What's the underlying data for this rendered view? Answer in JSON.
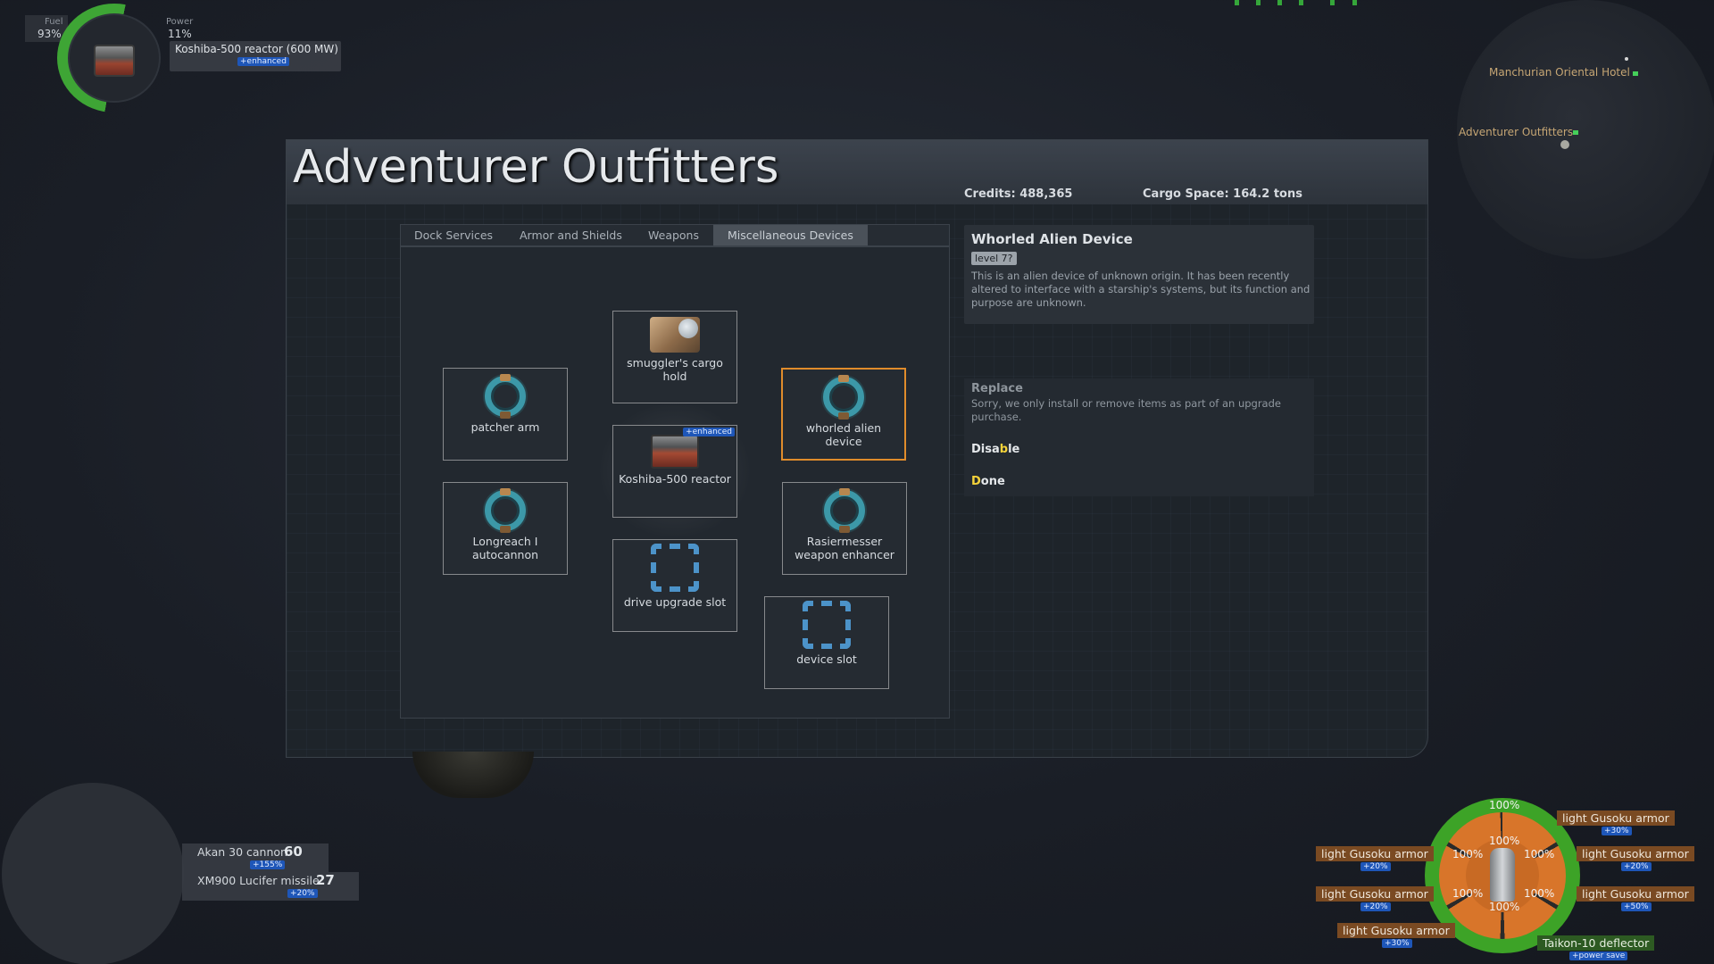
{
  "hud_top_left": {
    "fuel_label": "Fuel",
    "fuel_value": "93%",
    "power_label": "Power",
    "power_value": "11%",
    "reactor_name": "Koshiba-500 reactor (600 MW)",
    "reactor_badge": "+enhanced"
  },
  "minimap": {
    "locations": [
      "Manchurian Oriental Hotel",
      "Adventurer Outfitters"
    ]
  },
  "panel": {
    "title": "Adventurer Outfitters",
    "credits": "Credits: 488,365",
    "cargo": "Cargo Space:  164.2 tons"
  },
  "tabs": [
    "Dock Services",
    "Armor and Shields",
    "Weapons",
    "Miscellaneous Devices"
  ],
  "active_tab": "Miscellaneous Devices",
  "slots": {
    "cargo": {
      "label": "smuggler's cargo hold",
      "icon": "cargo-crate-icon"
    },
    "patcher": {
      "label": "patcher arm",
      "icon": "alien-ring-icon"
    },
    "whorled": {
      "label": "whorled alien device",
      "icon": "alien-ring-icon",
      "selected": true
    },
    "reactor": {
      "label": "Koshiba-500 reactor",
      "badge": "+enhanced",
      "icon": "reactor-icon"
    },
    "longreach": {
      "label": "Longreach I autocannon",
      "icon": "alien-ring-icon"
    },
    "rasier": {
      "label": "Rasiermesser weapon enhancer",
      "icon": "alien-ring-icon"
    },
    "drive": {
      "label": "drive upgrade slot",
      "icon": "empty-slot-icon"
    },
    "device": {
      "label": "device slot",
      "icon": "empty-slot-icon"
    }
  },
  "info": {
    "title": "Whorled Alien Device",
    "level": "level 7?",
    "description": "This is an alien device of unknown origin. It has been recently altered to interface with a starship's systems, but its function and purpose are unknown."
  },
  "actions": {
    "replace_label": "Replace",
    "replace_desc": "Sorry, we only install or remove items as part of an upgrade purchase.",
    "disable_pre": "Disa",
    "disable_key": "b",
    "disable_post": "le",
    "done_key": "D",
    "done_post": "one"
  },
  "weapons": [
    {
      "name": "Akan 30 cannon",
      "ammo": "60",
      "bonus": "+155%"
    },
    {
      "name": "XM900 Lucifer missile",
      "ammo": "27",
      "bonus": "+20%"
    }
  ],
  "armor_hud": {
    "percent": "100%",
    "armor_name": "light Gusoku armor",
    "bonuses": [
      "+30%",
      "+20%",
      "+20%",
      "+20%",
      "+50%",
      "+30%"
    ],
    "deflector": "Taikon-10 deflector",
    "deflector_badge": "+power save"
  },
  "colors": {
    "accent_selected": "#e08c2b",
    "hud_green": "#3da327",
    "armor_orange": "#d8752a",
    "hotkey_yellow": "#f4d23a",
    "badge_blue": "#1e56b8"
  }
}
